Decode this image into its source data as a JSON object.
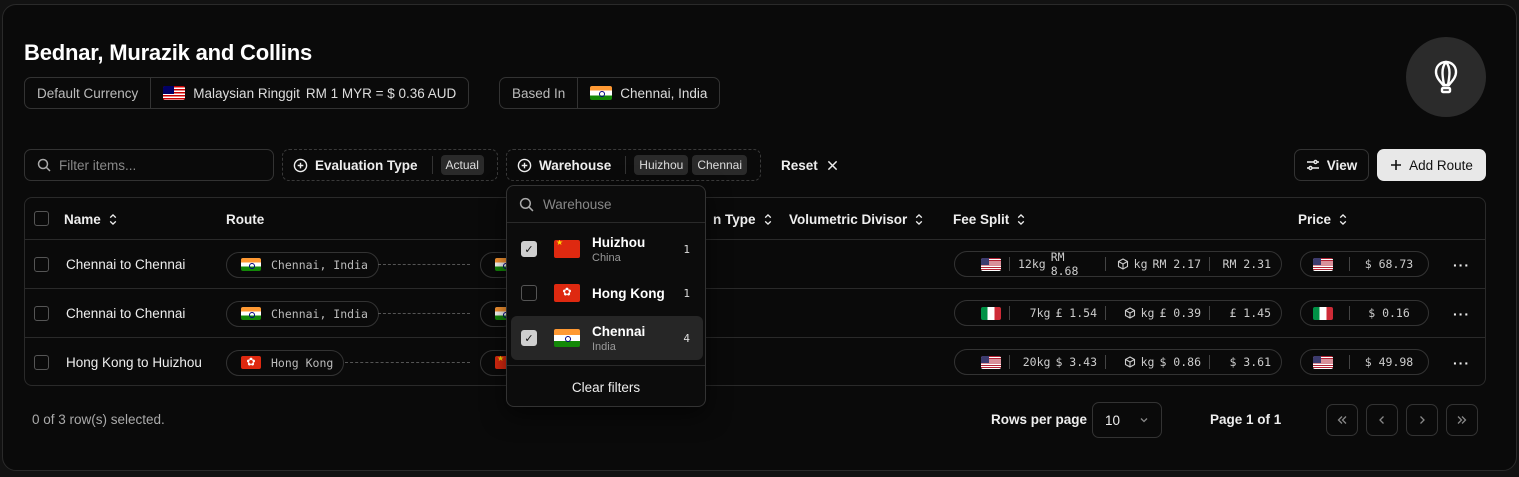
{
  "company": {
    "name": "Bednar, Murazik and Collins"
  },
  "currency": {
    "label": "Default Currency",
    "name": "Malaysian Ringgit",
    "rate": "RM 1 MYR = $ 0.36 AUD",
    "flag": "my"
  },
  "based_in": {
    "label": "Based In",
    "value": "Chennai, India",
    "flag": "in"
  },
  "toolbar": {
    "search_placeholder": "Filter items...",
    "evaluation_type_label": "Evaluation Type",
    "evaluation_type_values": [
      "Actual"
    ],
    "warehouse_label": "Warehouse",
    "warehouse_values": [
      "Huizhou",
      "Chennai"
    ],
    "reset_label": "Reset",
    "view_label": "View",
    "add_label": "Add Route"
  },
  "table": {
    "headers": {
      "name": "Name",
      "route": "Route",
      "evaluation_type": "n Type",
      "volumetric_divisor": "Volumetric Divisor",
      "fee_split": "Fee Split",
      "price": "Price"
    },
    "rows": [
      {
        "name": "Chennai to Chennai",
        "origin": "Chennai, India",
        "origin_flag": "in",
        "dest_flag": "in",
        "fee": {
          "flag": "us",
          "weight": "12kg",
          "weight_fee": "RM 8.68",
          "kg_label": "kg",
          "per_kg": "RM 2.17",
          "total": "RM 2.31"
        },
        "price": {
          "flag": "us",
          "value": "$ 68.73"
        }
      },
      {
        "name": "Chennai to Chennai",
        "origin": "Chennai, India",
        "origin_flag": "in",
        "dest_flag": "in",
        "fee": {
          "flag": "it",
          "weight": "7kg",
          "weight_fee": "£ 1.54",
          "kg_label": "kg",
          "per_kg": "£ 0.39",
          "total": "£ 1.45"
        },
        "price": {
          "flag": "it",
          "value": "$ 0.16"
        }
      },
      {
        "name": "Hong Kong to Huizhou",
        "origin": "Hong Kong",
        "origin_flag": "hk",
        "dest_flag": "cn",
        "fee": {
          "flag": "us",
          "weight": "20kg",
          "weight_fee": "$ 3.43",
          "kg_label": "kg",
          "per_kg": "$ 0.86",
          "total": "$ 3.61"
        },
        "price": {
          "flag": "us",
          "value": "$ 49.98"
        }
      }
    ]
  },
  "footer": {
    "selected_text": "0 of 3 row(s) selected.",
    "rows_per_page_label": "Rows per page",
    "rows_per_page_value": "10",
    "page_info": "Page 1 of 1"
  },
  "warehouse_dropdown": {
    "search_placeholder": "Warehouse",
    "options": [
      {
        "name": "Huizhou",
        "country": "China",
        "count": "1",
        "checked": true,
        "flag": "cn"
      },
      {
        "name": "Hong Kong",
        "country": "",
        "count": "1",
        "checked": false,
        "flag": "hk"
      },
      {
        "name": "Chennai",
        "country": "India",
        "count": "4",
        "checked": true,
        "flag": "in"
      }
    ],
    "clear_label": "Clear filters"
  }
}
